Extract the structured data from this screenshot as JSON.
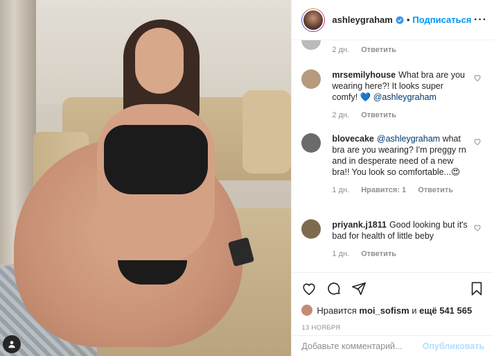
{
  "header": {
    "username": "ashleygraham",
    "separator": "•",
    "follow_label": "Подписаться",
    "more_label": "···"
  },
  "comments": {
    "top_partial": {
      "time": "2 дн.",
      "reply": "Ответить"
    },
    "items": [
      {
        "user": "mrsemilyhouse",
        "text": "What bra are you wearing here?! It looks super comfy! 💙 ",
        "mention": "@ashleygraham",
        "time": "2 дн.",
        "likes": "",
        "reply": "Ответить",
        "avatar_color": "#b59a7e"
      },
      {
        "user": "blovecake",
        "mention": "@ashleygraham",
        "text": " what bra are you wearing? I'm preggy rn and in desperate need of a new bra!! You look so comfortable...😍",
        "time": "1 дн.",
        "likes": "Нравится: 1",
        "reply": "Ответить",
        "avatar_color": "#6b6b6b"
      },
      {
        "user": "priyank.j1811",
        "text": "Good looking but it's bad for health of little beby",
        "time": "1 дн.",
        "likes": "",
        "reply": "Ответить",
        "avatar_color": "#7e6a4e"
      }
    ]
  },
  "likes": {
    "prefix": "Нравится",
    "user": "moi_sofism",
    "conj": "и",
    "count": "ещё 541 565"
  },
  "date": "13 НОЯБРЯ",
  "add_comment": {
    "placeholder": "Добавьте комментарий...",
    "post_label": "Опубликовать"
  },
  "colors": {
    "accent": "#0095f6",
    "verified": "#3897f0",
    "muted": "#8e8e8e"
  },
  "icons": [
    "verified-badge-icon",
    "heart-icon",
    "comment-icon",
    "share-icon",
    "bookmark-icon",
    "user-tag-icon"
  ]
}
